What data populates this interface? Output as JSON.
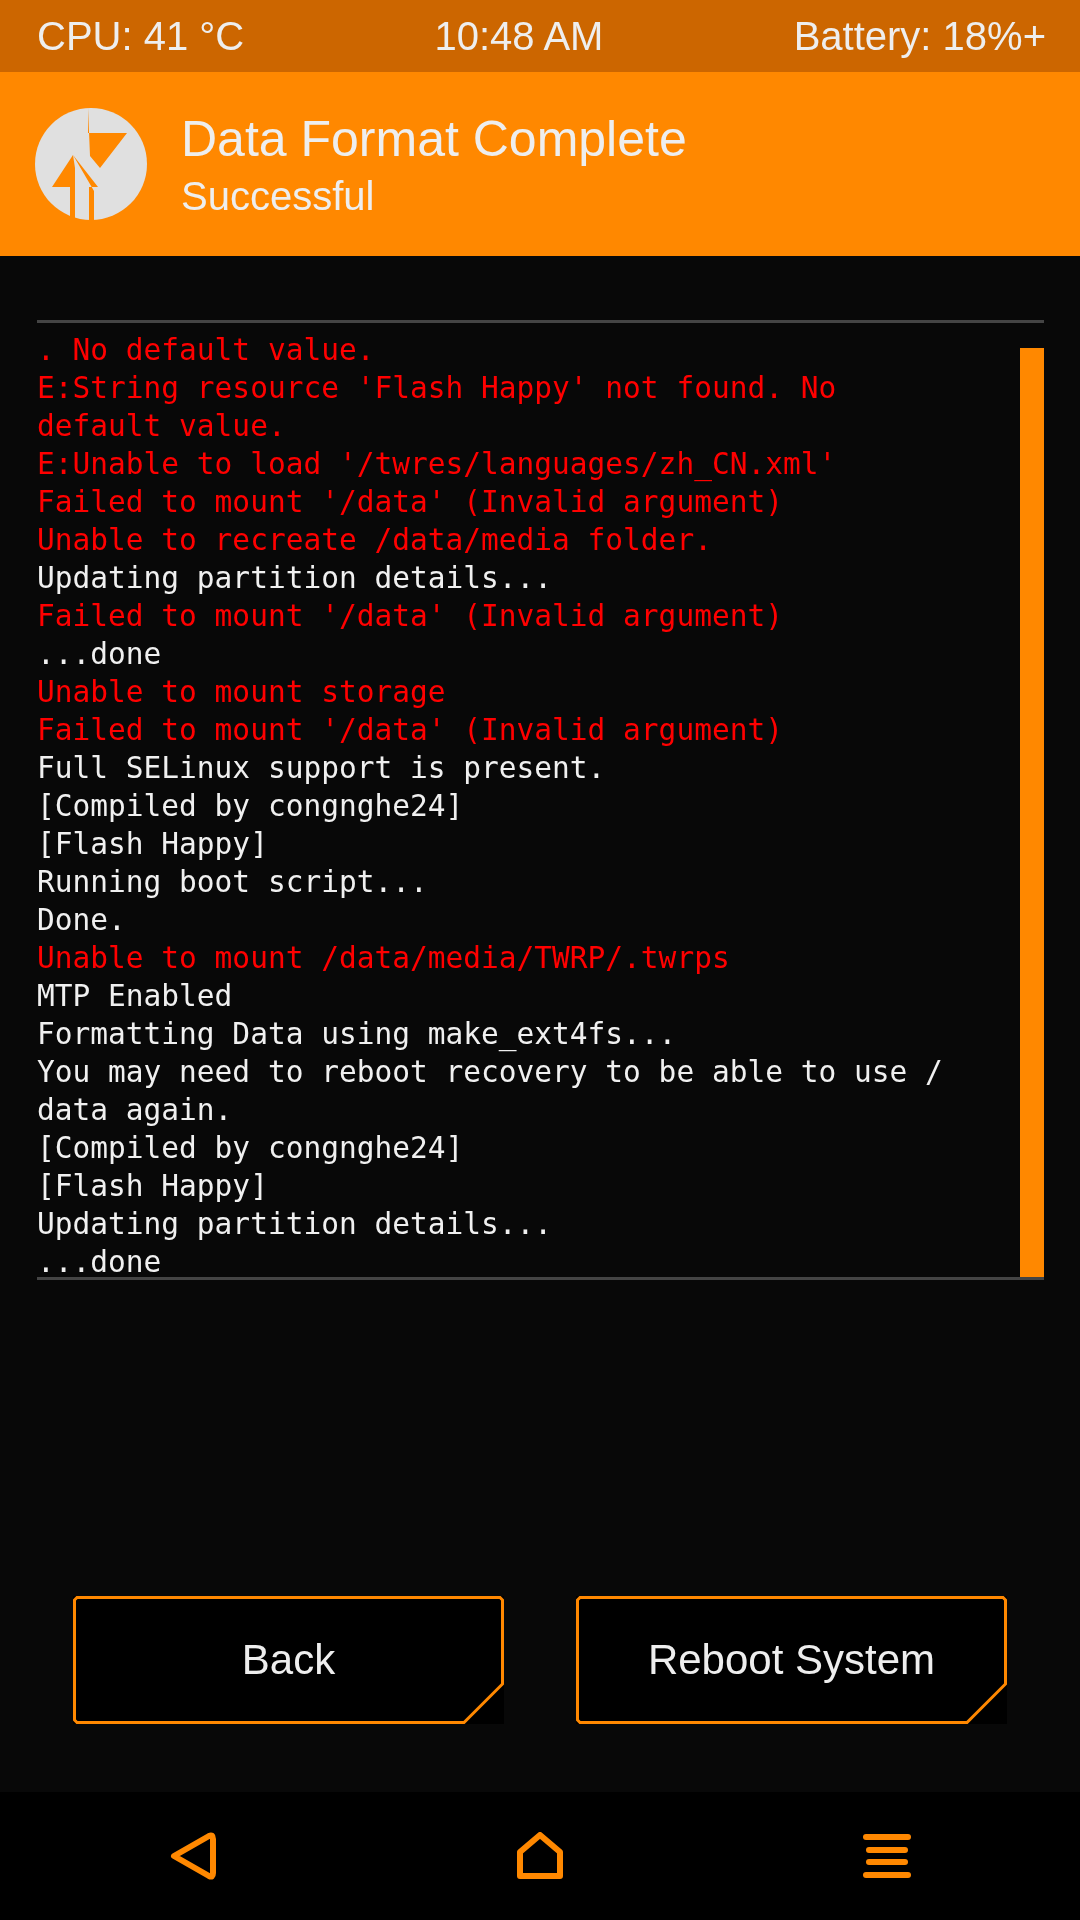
{
  "status_bar": {
    "cpu": "CPU: 41 °C",
    "time": "10:48 AM",
    "battery": "Battery: 18%+"
  },
  "header": {
    "title": "Data Format Complete",
    "subtitle": "Successful"
  },
  "log": [
    {
      "kind": "error",
      "text": ". No default value."
    },
    {
      "kind": "error",
      "text": "E:String resource 'Flash Happy' not found. No"
    },
    {
      "kind": "error",
      "text": "default value."
    },
    {
      "kind": "error",
      "text": "E:Unable to load '/twres/languages/zh_CN.xml'"
    },
    {
      "kind": "error",
      "text": "Failed to mount '/data' (Invalid argument)"
    },
    {
      "kind": "error",
      "text": "Unable to recreate /data/media folder."
    },
    {
      "kind": "info",
      "text": "Updating partition details..."
    },
    {
      "kind": "error",
      "text": "Failed to mount '/data' (Invalid argument)"
    },
    {
      "kind": "info",
      "text": "...done"
    },
    {
      "kind": "error",
      "text": "Unable to mount storage"
    },
    {
      "kind": "error",
      "text": "Failed to mount '/data' (Invalid argument)"
    },
    {
      "kind": "info",
      "text": "Full SELinux support is present."
    },
    {
      "kind": "info",
      "text": "[Compiled by congnghe24]"
    },
    {
      "kind": "info",
      "text": "[Flash Happy]"
    },
    {
      "kind": "info",
      "text": "Running boot script..."
    },
    {
      "kind": "info",
      "text": "Done."
    },
    {
      "kind": "error",
      "text": "Unable to mount /data/media/TWRP/.twrps"
    },
    {
      "kind": "info",
      "text": "MTP Enabled"
    },
    {
      "kind": "info",
      "text": "Formatting Data using make_ext4fs..."
    },
    {
      "kind": "info",
      "text": "You may need to reboot recovery to be able to use /"
    },
    {
      "kind": "info",
      "text": "data again."
    },
    {
      "kind": "info",
      "text": "[Compiled by congnghe24]"
    },
    {
      "kind": "info",
      "text": "[Flash Happy]"
    },
    {
      "kind": "info",
      "text": "Updating partition details..."
    },
    {
      "kind": "info",
      "text": "...done"
    }
  ],
  "buttons": [
    "Back",
    "Reboot System"
  ]
}
